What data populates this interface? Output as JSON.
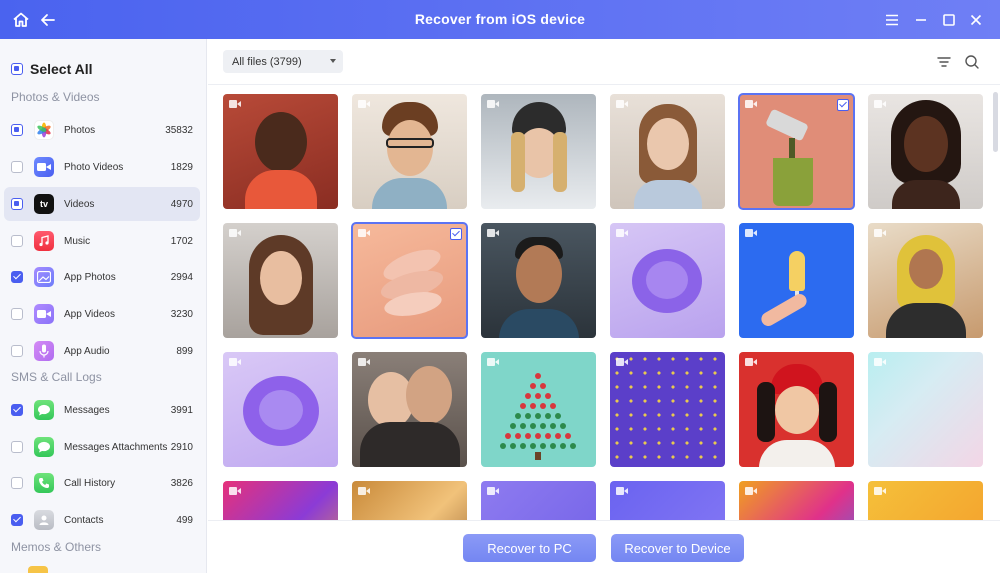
{
  "window": {
    "title": "Recover from iOS device"
  },
  "sidebar": {
    "select_all": "Select All",
    "sections": {
      "photos_videos": "Photos & Videos",
      "sms_call_logs": "SMS & Call Logs",
      "memos_others": "Memos & Others"
    },
    "items": [
      {
        "label": "Photos",
        "count": "35832",
        "state": "partial",
        "icon": "photos-icon"
      },
      {
        "label": "Photo Videos",
        "count": "1829",
        "state": "unchecked",
        "icon": "photo-videos-icon"
      },
      {
        "label": "Videos",
        "count": "4970",
        "state": "partial",
        "icon": "apple-tv-icon",
        "icon_text": "tv"
      },
      {
        "label": "Music",
        "count": "1702",
        "state": "unchecked",
        "icon": "music-icon"
      },
      {
        "label": "App Photos",
        "count": "2994",
        "state": "checked",
        "icon": "app-photos-icon"
      },
      {
        "label": "App Videos",
        "count": "3230",
        "state": "unchecked",
        "icon": "app-videos-icon"
      },
      {
        "label": "App Audio",
        "count": "899",
        "state": "unchecked",
        "icon": "app-audio-icon"
      },
      {
        "label": "Messages",
        "count": "3991",
        "state": "checked",
        "icon": "messages-icon"
      },
      {
        "label": "Messages Attachments",
        "count": "2910",
        "state": "unchecked",
        "icon": "message-attachments-icon"
      },
      {
        "label": "Call History",
        "count": "3826",
        "state": "unchecked",
        "icon": "phone-icon"
      },
      {
        "label": "Contacts",
        "count": "499",
        "state": "checked",
        "icon": "contacts-icon"
      }
    ]
  },
  "toolbar": {
    "filter_value": "All files (3799)"
  },
  "footer": {
    "recover_pc": "Recover to PC",
    "recover_device": "Recover to Device"
  },
  "colors": {
    "accent": "#4a5ef0",
    "titlebar": "#5b6ff2",
    "button": "#7e8ff4"
  }
}
